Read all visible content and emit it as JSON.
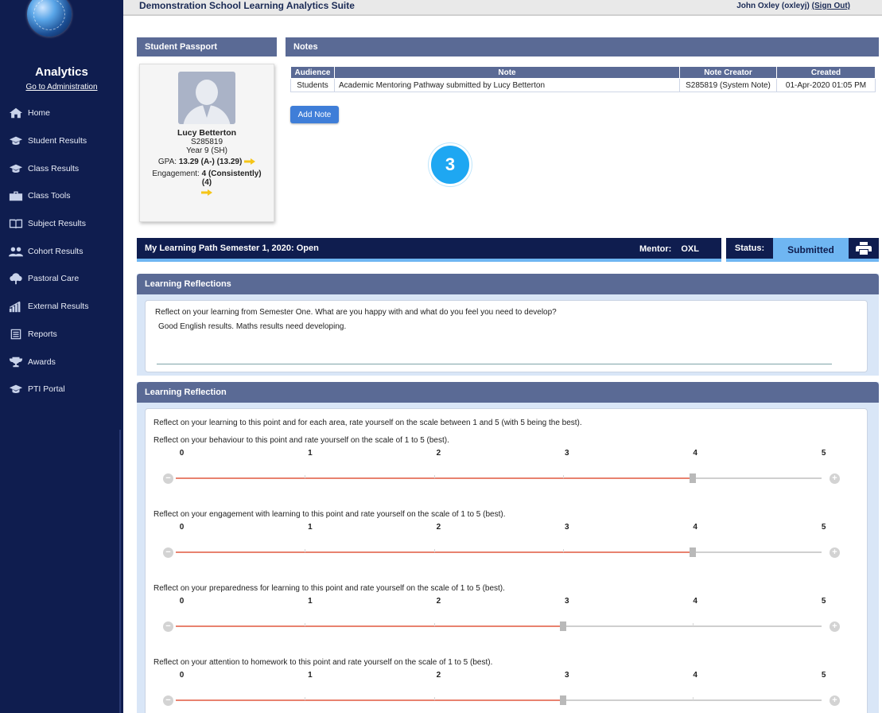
{
  "topbar": {
    "suite_title": "Demonstration School Learning Analytics Suite",
    "user": "John Oxley (oxleyj)",
    "sign_out": "(Sign Out)"
  },
  "sidebar": {
    "app_title": "Analytics",
    "admin_link": "Go to Administration",
    "items": [
      {
        "label": "Home",
        "icon": "home-icon"
      },
      {
        "label": "Student Results",
        "icon": "graduation-cap-icon"
      },
      {
        "label": "Class Results",
        "icon": "graduation-cap-icon"
      },
      {
        "label": "Class Tools",
        "icon": "toolbox-icon"
      },
      {
        "label": "Subject Results",
        "icon": "book-icon"
      },
      {
        "label": "Cohort Results",
        "icon": "users-icon"
      },
      {
        "label": "Pastoral Care",
        "icon": "tree-icon"
      },
      {
        "label": "External Results",
        "icon": "bar-chart-icon"
      },
      {
        "label": "Reports",
        "icon": "report-icon"
      },
      {
        "label": "Awards",
        "icon": "trophy-icon"
      },
      {
        "label": "PTI Portal",
        "icon": "graduation-cap-icon"
      }
    ]
  },
  "passport": {
    "heading": "Student Passport",
    "name": "Lucy Betterton",
    "student_id": "S285819",
    "year": "Year 9 (SH)",
    "gpa_label": "GPA:",
    "gpa_value": "13.29 (A-) (13.29)",
    "engagement_label": "Engagement:",
    "engagement_value": "4 (Consistently) (4)"
  },
  "notes": {
    "heading": "Notes",
    "columns": [
      "Audience",
      "Note",
      "Note Creator",
      "Created"
    ],
    "rows": [
      {
        "audience": "Students",
        "note": "Academic Mentoring Pathway submitted by Lucy Betterton",
        "creator": "S285819 (System Note)",
        "created": "01-Apr-2020 01:05 PM"
      }
    ],
    "add_button": "Add Note"
  },
  "step_badge": "3",
  "learning_path": {
    "title": "My Learning Path Semester 1, 2020: Open",
    "mentor_label": "Mentor:",
    "mentor_value": "OXL",
    "status_label": "Status:",
    "status_value": "Submitted"
  },
  "reflections": {
    "heading": "Learning Reflections",
    "question": "Reflect on your learning from Semester One. What are you happy with and what do you feel you need to develop?",
    "answer": "Good English results. Maths results need developing."
  },
  "reflection": {
    "heading": "Learning Reflection",
    "intro": "Reflect on your learning to this point and for each area, rate yourself on the scale between 1 and 5 (with 5 being the best).",
    "scale_labels": [
      "0",
      "1",
      "2",
      "3",
      "4",
      "5"
    ],
    "sliders": [
      {
        "question": "Reflect on your behaviour to this point and rate yourself on the scale of 1 to 5 (best).",
        "value": 4
      },
      {
        "question": "Reflect on your engagement with learning to this point and rate yourself on the scale of 1 to 5 (best).",
        "value": 4
      },
      {
        "question": "Reflect on your preparedness for learning to this point and rate yourself on the scale of 1 to 5 (best).",
        "value": 3
      },
      {
        "question": "Reflect on your attention to homework to this point and rate yourself on the scale of 1 to 5 (best).",
        "value": 3
      }
    ],
    "minus_symbol": "−",
    "plus_symbol": "+"
  }
}
